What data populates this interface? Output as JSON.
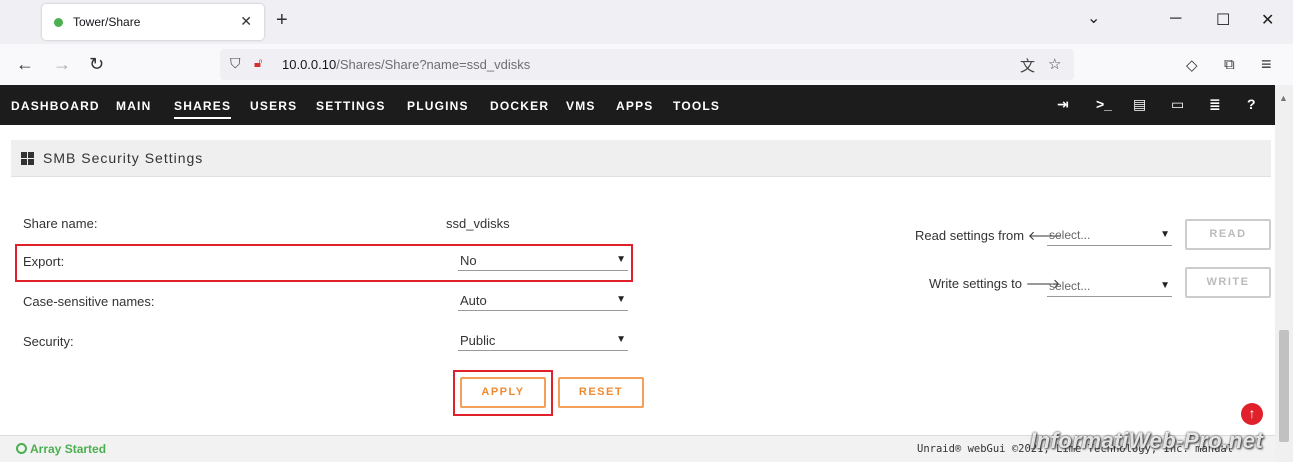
{
  "browser": {
    "tab_title": "Tower/Share",
    "tab_close": "✕",
    "new_tab": "+",
    "url_host": "10.0.0.10",
    "url_path": "/Shares/Share?name=ssd_vdisks"
  },
  "menu": {
    "items": [
      "DASHBOARD",
      "MAIN",
      "SHARES",
      "USERS",
      "SETTINGS",
      "PLUGINS",
      "DOCKER",
      "VMS",
      "APPS",
      "TOOLS"
    ],
    "active": "SHARES"
  },
  "section": {
    "title": "SMB Security Settings"
  },
  "form": {
    "share_name_label": "Share name:",
    "share_name_value": "ssd_vdisks",
    "export_label": "Export:",
    "export_value": "No",
    "case_label": "Case-sensitive names:",
    "case_value": "Auto",
    "security_label": "Security:",
    "security_value": "Public",
    "apply_label": "APPLY",
    "reset_label": "RESET"
  },
  "side": {
    "read_label": "Read settings from",
    "read_select": "select...",
    "read_button": "READ",
    "write_label": "Write settings to",
    "write_select": "select...",
    "write_button": "WRITE"
  },
  "footer": {
    "status": "Array Started",
    "copyright": "Unraid® webGui ©2021, Lime Technology, Inc. manual"
  },
  "watermark": "InformatiWeb-Pro.net",
  "colors": {
    "accent": "#f08a30",
    "highlight": "#e0202a",
    "status_green": "#4caf50",
    "menubar": "#1c1c1c"
  }
}
